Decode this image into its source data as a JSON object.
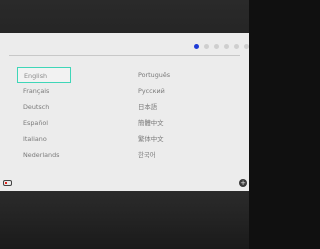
{
  "screen": {
    "pagination": {
      "total": 6,
      "active_index": 0
    },
    "languages_left": [
      {
        "label": "English",
        "selected": true
      },
      {
        "label": "Français",
        "selected": false
      },
      {
        "label": "Deutsch",
        "selected": false
      },
      {
        "label": "Español",
        "selected": false
      },
      {
        "label": "Italiano",
        "selected": false
      },
      {
        "label": "Nederlands",
        "selected": false
      }
    ],
    "languages_right": [
      {
        "label": "Português",
        "selected": false
      },
      {
        "label": "Русский",
        "selected": false
      },
      {
        "label": "日本語",
        "selected": false
      },
      {
        "label": "簡體中文",
        "selected": false
      },
      {
        "label": "繁体中文",
        "selected": false
      },
      {
        "label": "한국어",
        "selected": false
      }
    ],
    "bottom": {
      "left_icon": "controller-icon",
      "right_icon": "plus-icon",
      "right_icon_glyph": "+"
    }
  },
  "colors": {
    "screen_bg": "#ececec",
    "selection_outline": "#3fd6b8",
    "pager_active": "#1e3bd6",
    "pager_inactive": "#cfcfcf",
    "text": "#7a7a7a"
  }
}
